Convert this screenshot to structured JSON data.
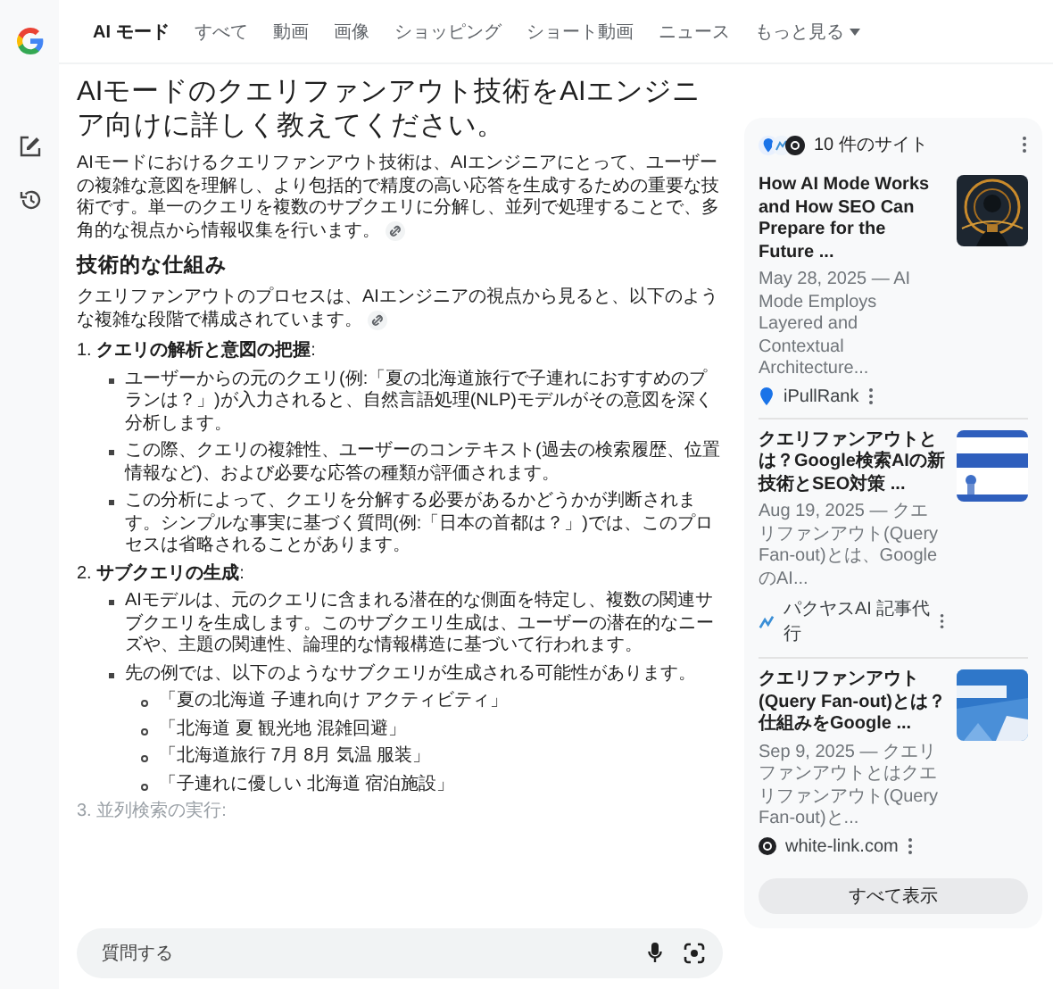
{
  "nav": {
    "tabs": [
      {
        "label": "AI モード",
        "selected": true
      },
      {
        "label": "すべて",
        "selected": false
      },
      {
        "label": "動画",
        "selected": false
      },
      {
        "label": "画像",
        "selected": false
      },
      {
        "label": "ショッピング",
        "selected": false
      },
      {
        "label": "ショート動画",
        "selected": false
      },
      {
        "label": "ニュース",
        "selected": false
      }
    ],
    "more": "もっと見る"
  },
  "answer": {
    "title": "AIモードのクエリファンアウト技術をAIエンジニア向けに詳しく教えてください。",
    "blocks": [
      {
        "kind": "paragraph",
        "text": "AIモードにおけるクエリファンアウト技術は、AIエンジニアにとって、ユーザーの複雑な意図を理解し、より包括的で精度の高い応答を生成するための重要な技術です。単一のクエリを複数のサブクエリに分解し、並列で処理することで、多角的な視点から情報収集を行います。",
        "cited": true
      },
      {
        "kind": "heading",
        "text": "技術的な仕組み"
      },
      {
        "kind": "paragraph",
        "text": "クエリファンアウトのプロセスは、AIエンジニアの視点から見ると、以下のような複雑な段階で構成されています。",
        "cited": true
      },
      {
        "kind": "step",
        "number": "1.",
        "label": "**クエリの解析と意図の把握**:",
        "faded": false,
        "items": [
          {
            "text": "ユーザーからの元のクエリ(例:「夏の北海道旅行で子連れにおすすめのプランは？」)が入力されると、自然言語処理(NLP)モデルがその意図を深く分析します。"
          },
          {
            "text": "この際、クエリの複雑性、ユーザーのコンテキスト(過去の検索履歴、位置情報など)、および必要な応答の種類が評価されます。"
          },
          {
            "text": "この分析によって、クエリを分解する必要があるかどうかが判断されます。シンプルな事実に基づく質問(例:「日本の首都は？」)では、このプロセスは省略されることがあります。"
          }
        ]
      },
      {
        "kind": "step",
        "number": "2.",
        "label": "**サブクエリの生成**:",
        "faded": false,
        "items": [
          {
            "text": "AIモデルは、元のクエリに含まれる潜在的な側面を特定し、複数の関連サブクエリを生成します。このサブクエリ生成は、ユーザーの潜在的なニーズや、主題の関連性、論理的な情報構造に基づいて行われます。"
          },
          {
            "text": "先の例では、以下のようなサブクエリが生成される可能性があります。",
            "children": [
              {
                "text": "「夏の北海道 子連れ向け アクティビティ」"
              },
              {
                "text": "「北海道 夏 観光地 混雑回避」"
              },
              {
                "text": "「北海道旅行 7月 8月 気温 服装」"
              },
              {
                "text": "「子連れに優しい 北海道 宿泊施設」"
              }
            ]
          }
        ]
      },
      {
        "kind": "step",
        "number": "3.",
        "label": "並列検索の実行:",
        "faded": true
      }
    ]
  },
  "sources": {
    "count": "10 件のサイト",
    "items": [
      {
        "title": "How AI Mode Works and How SEO Can Prepare for the Future ...",
        "snippet": "May 28, 2025 — AI Mode Employs Layered and Contextual Architecture...",
        "site": "iPullRank",
        "kind": "pin"
      },
      {
        "title": "クエリファンアウトとは？Google検索AIの新技術とSEO対策 ...",
        "snippet": "Aug 19, 2025 — クエリファンアウト(Query Fan-out)とは、GoogleのAI...",
        "site": "パクヤスAI 記事代行",
        "kind": "chart"
      },
      {
        "title": "クエリファンアウト(Query Fan-out)とは？仕組みをGoogle ...",
        "snippet": "Sep 9, 2025 — クエリファンアウトとはクエリファンアウト(Query Fan-out)と...",
        "site": "white-link.com",
        "kind": "circle"
      }
    ],
    "show_all": "すべて表示"
  },
  "input": {
    "placeholder": "質問する"
  }
}
